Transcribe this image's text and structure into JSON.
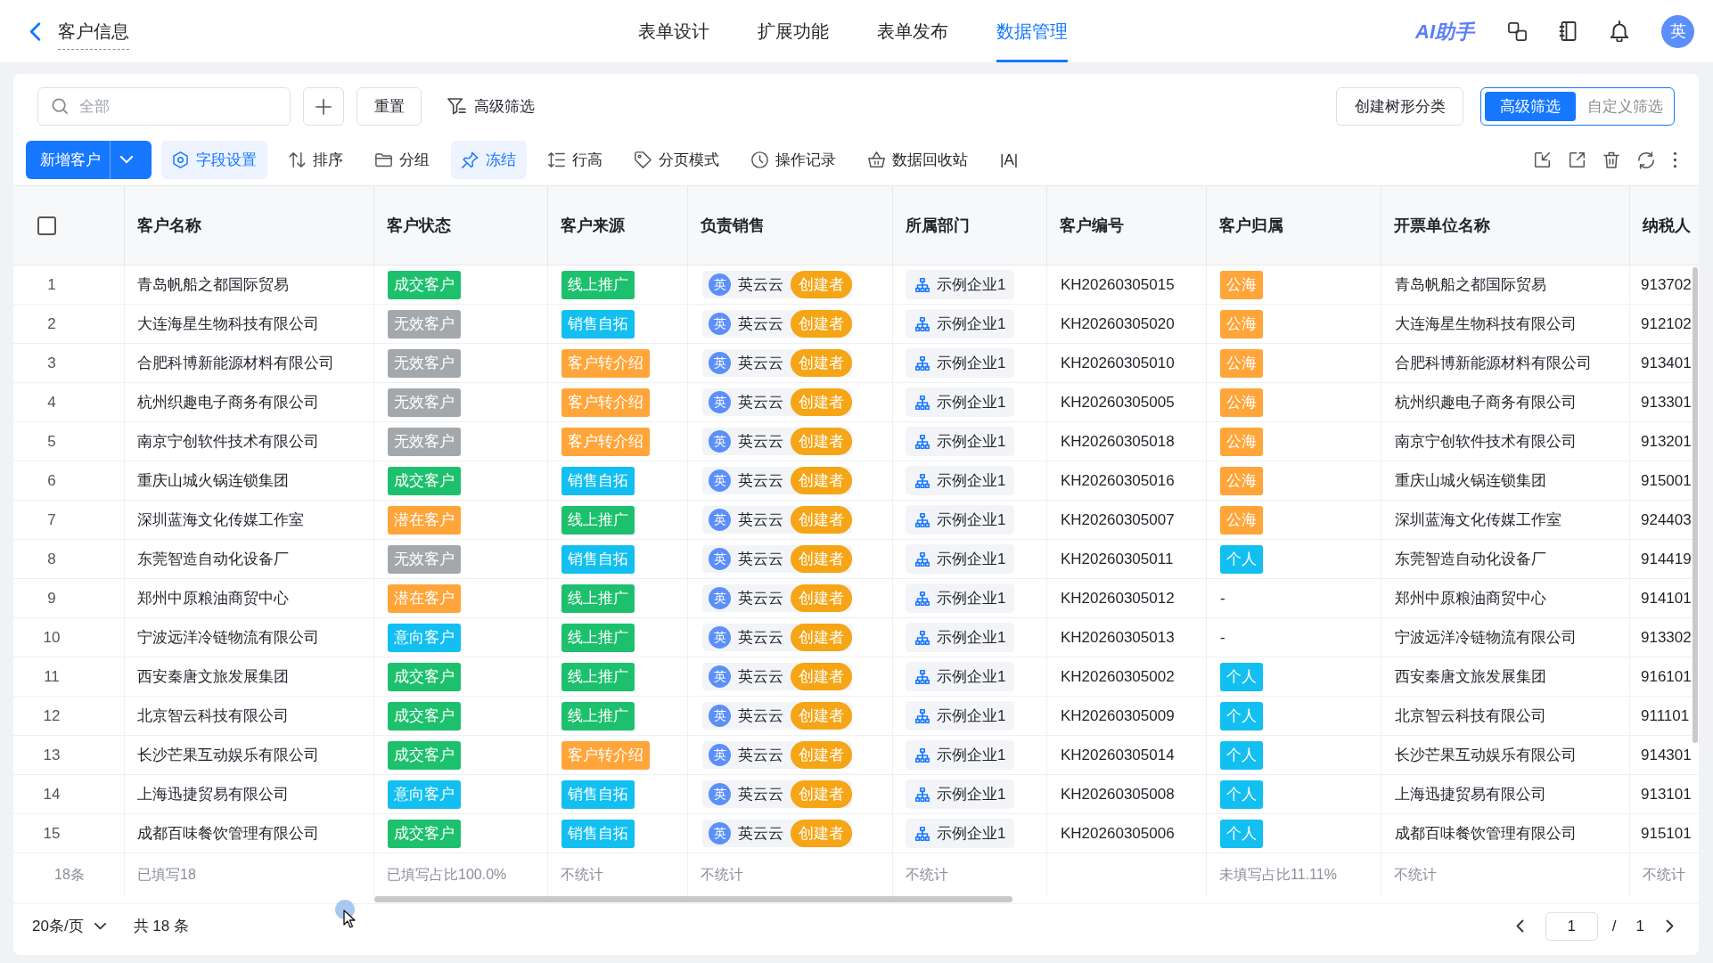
{
  "top_bar": {
    "title": "客户信息",
    "tabs": [
      {
        "label": "表单设计",
        "selected": false
      },
      {
        "label": "扩展功能",
        "selected": false
      },
      {
        "label": "表单发布",
        "selected": false
      },
      {
        "label": "数据管理",
        "selected": true
      }
    ],
    "assistant": "AI助手",
    "avatar": "英"
  },
  "filter_bar": {
    "search": {
      "placeholder": "全部"
    },
    "reset_button": "重置",
    "advanced_filter": "高级筛选",
    "tree_button": "创建树形分类",
    "filter_modes": [
      {
        "label": "高级筛选",
        "selected": true
      },
      {
        "label": "自定义筛选",
        "selected": false
      }
    ]
  },
  "toolbar": {
    "add_button": "新增客户",
    "items": [
      {
        "label": "字段设置",
        "active": true
      },
      {
        "label": "排序",
        "active": false
      },
      {
        "label": "分组",
        "active": false
      },
      {
        "label": "冻结",
        "active": true
      },
      {
        "label": "行高",
        "active": false
      },
      {
        "label": "分页模式",
        "active": false
      },
      {
        "label": "操作记录",
        "active": false
      },
      {
        "label": "数据回收站",
        "active": false
      },
      {
        "label": "|A|",
        "active": false
      }
    ]
  },
  "table": {
    "select_all": {
      "checked": false
    },
    "columns": [
      "客户名称",
      "客户状态",
      "客户来源",
      "负责销售",
      "所属部门",
      "客户编号",
      "客户归属",
      "开票单位名称",
      "纳税人"
    ],
    "rows": [
      {
        "index": "1",
        "name": "青岛帆船之都国际贸易",
        "status": {
          "label": "成交客户",
          "color": "#1dc06d"
        },
        "source": {
          "label": "线上推广",
          "color": "#1dc06d"
        },
        "sales": {
          "avatar": "英",
          "name": "英云云",
          "role": "创建者"
        },
        "department": "示例企业1",
        "code": "KH20260305015",
        "ownership": {
          "label": "公海",
          "color": "#ffa53a"
        },
        "invoice_name": "青岛帆船之都国际贸易",
        "tax_id": "913702"
      },
      {
        "index": "2",
        "name": "大连海星生物科技有限公司",
        "status": {
          "label": "无效客户",
          "color": "#a3a8ac"
        },
        "source": {
          "label": "销售自拓",
          "color": "#13bff0"
        },
        "sales": {
          "avatar": "英",
          "name": "英云云",
          "role": "创建者"
        },
        "department": "示例企业1",
        "code": "KH20260305020",
        "ownership": {
          "label": "公海",
          "color": "#ffa53a"
        },
        "invoice_name": "大连海星生物科技有限公司",
        "tax_id": "912102"
      },
      {
        "index": "3",
        "name": "合肥科博新能源材料有限公司",
        "status": {
          "label": "无效客户",
          "color": "#a3a8ac"
        },
        "source": {
          "label": "客户转介绍",
          "color": "#ffa53a"
        },
        "sales": {
          "avatar": "英",
          "name": "英云云",
          "role": "创建者"
        },
        "department": "示例企业1",
        "code": "KH20260305010",
        "ownership": {
          "label": "公海",
          "color": "#ffa53a"
        },
        "invoice_name": "合肥科博新能源材料有限公司",
        "tax_id": "913401"
      },
      {
        "index": "4",
        "name": "杭州织趣电子商务有限公司",
        "status": {
          "label": "无效客户",
          "color": "#a3a8ac"
        },
        "source": {
          "label": "客户转介绍",
          "color": "#ffa53a"
        },
        "sales": {
          "avatar": "英",
          "name": "英云云",
          "role": "创建者"
        },
        "department": "示例企业1",
        "code": "KH20260305005",
        "ownership": {
          "label": "公海",
          "color": "#ffa53a"
        },
        "invoice_name": "杭州织趣电子商务有限公司",
        "tax_id": "913301"
      },
      {
        "index": "5",
        "name": "南京宁创软件技术有限公司",
        "status": {
          "label": "无效客户",
          "color": "#a3a8ac"
        },
        "source": {
          "label": "客户转介绍",
          "color": "#ffa53a"
        },
        "sales": {
          "avatar": "英",
          "name": "英云云",
          "role": "创建者"
        },
        "department": "示例企业1",
        "code": "KH20260305018",
        "ownership": {
          "label": "公海",
          "color": "#ffa53a"
        },
        "invoice_name": "南京宁创软件技术有限公司",
        "tax_id": "913201"
      },
      {
        "index": "6",
        "name": "重庆山城火锅连锁集团",
        "status": {
          "label": "成交客户",
          "color": "#1dc06d"
        },
        "source": {
          "label": "销售自拓",
          "color": "#13bff0"
        },
        "sales": {
          "avatar": "英",
          "name": "英云云",
          "role": "创建者"
        },
        "department": "示例企业1",
        "code": "KH20260305016",
        "ownership": {
          "label": "公海",
          "color": "#ffa53a"
        },
        "invoice_name": "重庆山城火锅连锁集团",
        "tax_id": "915001"
      },
      {
        "index": "7",
        "name": "深圳蓝海文化传媒工作室",
        "status": {
          "label": "潜在客户",
          "color": "#ffa53a"
        },
        "source": {
          "label": "线上推广",
          "color": "#1dc06d"
        },
        "sales": {
          "avatar": "英",
          "name": "英云云",
          "role": "创建者"
        },
        "department": "示例企业1",
        "code": "KH20260305007",
        "ownership": {
          "label": "公海",
          "color": "#ffa53a"
        },
        "invoice_name": "深圳蓝海文化传媒工作室",
        "tax_id": "924403"
      },
      {
        "index": "8",
        "name": "东莞智造自动化设备厂",
        "status": {
          "label": "无效客户",
          "color": "#a3a8ac"
        },
        "source": {
          "label": "销售自拓",
          "color": "#13bff0"
        },
        "sales": {
          "avatar": "英",
          "name": "英云云",
          "role": "创建者"
        },
        "department": "示例企业1",
        "code": "KH20260305011",
        "ownership": {
          "label": "个人",
          "color": "#13bff0"
        },
        "invoice_name": "东莞智造自动化设备厂",
        "tax_id": "914419"
      },
      {
        "index": "9",
        "name": "郑州中原粮油商贸中心",
        "status": {
          "label": "潜在客户",
          "color": "#ffa53a"
        },
        "source": {
          "label": "线上推广",
          "color": "#1dc06d"
        },
        "sales": {
          "avatar": "英",
          "name": "英云云",
          "role": "创建者"
        },
        "department": "示例企业1",
        "code": "KH20260305012",
        "ownership": {
          "label": "-"
        },
        "invoice_name": "郑州中原粮油商贸中心",
        "tax_id": "914101"
      },
      {
        "index": "10",
        "name": "宁波远洋冷链物流有限公司",
        "status": {
          "label": "意向客户",
          "color": "#13bff0"
        },
        "source": {
          "label": "线上推广",
          "color": "#1dc06d"
        },
        "sales": {
          "avatar": "英",
          "name": "英云云",
          "role": "创建者"
        },
        "department": "示例企业1",
        "code": "KH20260305013",
        "ownership": {
          "label": "-"
        },
        "invoice_name": "宁波远洋冷链物流有限公司",
        "tax_id": "913302"
      },
      {
        "index": "11",
        "name": "西安秦唐文旅发展集团",
        "status": {
          "label": "成交客户",
          "color": "#1dc06d"
        },
        "source": {
          "label": "线上推广",
          "color": "#1dc06d"
        },
        "sales": {
          "avatar": "英",
          "name": "英云云",
          "role": "创建者"
        },
        "department": "示例企业1",
        "code": "KH20260305002",
        "ownership": {
          "label": "个人",
          "color": "#13bff0"
        },
        "invoice_name": "西安秦唐文旅发展集团",
        "tax_id": "916101"
      },
      {
        "index": "12",
        "name": "北京智云科技有限公司",
        "status": {
          "label": "成交客户",
          "color": "#1dc06d"
        },
        "source": {
          "label": "线上推广",
          "color": "#1dc06d"
        },
        "sales": {
          "avatar": "英",
          "name": "英云云",
          "role": "创建者"
        },
        "department": "示例企业1",
        "code": "KH20260305009",
        "ownership": {
          "label": "个人",
          "color": "#13bff0"
        },
        "invoice_name": "北京智云科技有限公司",
        "tax_id": "911101"
      },
      {
        "index": "13",
        "name": "长沙芒果互动娱乐有限公司",
        "status": {
          "label": "成交客户",
          "color": "#1dc06d"
        },
        "source": {
          "label": "客户转介绍",
          "color": "#ffa53a"
        },
        "sales": {
          "avatar": "英",
          "name": "英云云",
          "role": "创建者"
        },
        "department": "示例企业1",
        "code": "KH20260305014",
        "ownership": {
          "label": "个人",
          "color": "#13bff0"
        },
        "invoice_name": "长沙芒果互动娱乐有限公司",
        "tax_id": "914301"
      },
      {
        "index": "14",
        "name": "上海迅捷贸易有限公司",
        "status": {
          "label": "意向客户",
          "color": "#13bff0"
        },
        "source": {
          "label": "销售自拓",
          "color": "#13bff0"
        },
        "sales": {
          "avatar": "英",
          "name": "英云云",
          "role": "创建者"
        },
        "department": "示例企业1",
        "code": "KH20260305008",
        "ownership": {
          "label": "个人",
          "color": "#13bff0"
        },
        "invoice_name": "上海迅捷贸易有限公司",
        "tax_id": "913101"
      },
      {
        "index": "15",
        "name": "成都百味餐饮管理有限公司",
        "status": {
          "label": "成交客户",
          "color": "#1dc06d"
        },
        "source": {
          "label": "销售自拓",
          "color": "#13bff0"
        },
        "sales": {
          "avatar": "英",
          "name": "英云云",
          "role": "创建者"
        },
        "department": "示例企业1",
        "code": "KH20260305006",
        "ownership": {
          "label": "个人",
          "color": "#13bff0"
        },
        "invoice_name": "成都百味餐饮管理有限公司",
        "tax_id": "915101"
      }
    ],
    "summary": {
      "count": "18条",
      "name": "已填写18",
      "status": "已填写占比100.0%",
      "source": "不统计",
      "sales": "不统计",
      "department": "不统计",
      "ownership": "未填写占比11.11%",
      "invoice_name": "不统计",
      "tax_id": "不统计"
    }
  },
  "pagination": {
    "page_size": "20条/页",
    "total": "共 18 条",
    "page": {
      "value": "1"
    },
    "separator": "/",
    "page_count": "1"
  }
}
